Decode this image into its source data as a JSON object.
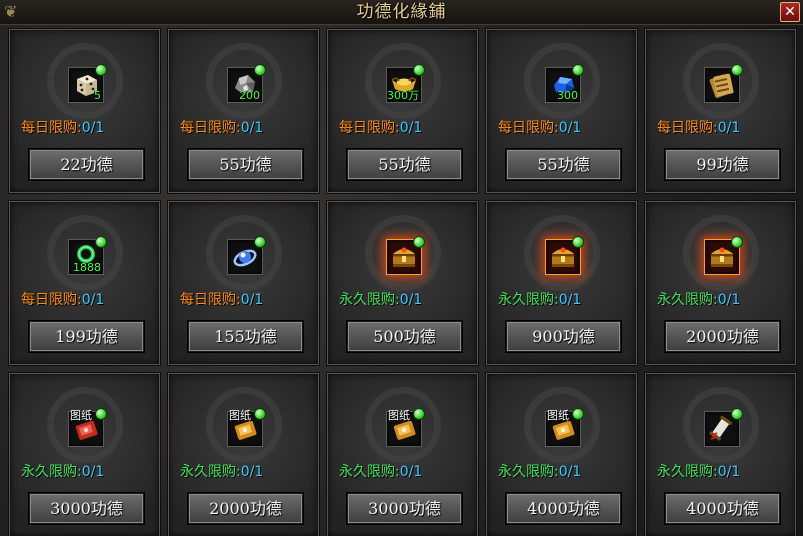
{
  "window": {
    "title": "功德化緣鋪",
    "close_glyph": "✕",
    "ornament": "❦"
  },
  "items": [
    {
      "icon": "dice-icon",
      "qty": "5",
      "tag": "",
      "glow": false,
      "limit_label": "每日限购:",
      "limit_kind": "daily",
      "limit_count": "0/1",
      "price": "22功德"
    },
    {
      "icon": "ore-icon",
      "qty": "200",
      "tag": "",
      "glow": false,
      "limit_label": "每日限购:",
      "limit_kind": "daily",
      "limit_count": "0/1",
      "price": "55功德"
    },
    {
      "icon": "gold-ingot-icon",
      "qty": "300万",
      "tag": "",
      "glow": false,
      "limit_label": "每日限购:",
      "limit_kind": "daily",
      "limit_count": "0/1",
      "price": "55功德"
    },
    {
      "icon": "blue-gem-icon",
      "qty": "300",
      "tag": "",
      "glow": false,
      "limit_label": "每日限购:",
      "limit_kind": "daily",
      "limit_count": "0/1",
      "price": "55功德"
    },
    {
      "icon": "scroll-bundle-icon",
      "qty": "",
      "tag": "",
      "glow": false,
      "limit_label": "每日限购:",
      "limit_kind": "daily",
      "limit_count": "0/1",
      "price": "99功德"
    },
    {
      "icon": "green-ring-icon",
      "qty": "1888",
      "tag": "",
      "glow": false,
      "limit_label": "每日限购:",
      "limit_kind": "daily",
      "limit_count": "0/1",
      "price": "199功德"
    },
    {
      "icon": "blue-orb-icon",
      "qty": "",
      "tag": "",
      "glow": false,
      "limit_label": "每日限购:",
      "limit_kind": "daily",
      "limit_count": "0/1",
      "price": "155功德"
    },
    {
      "icon": "treasure-chest-icon",
      "qty": "",
      "tag": "",
      "glow": true,
      "limit_label": "永久限购:",
      "limit_kind": "perm",
      "limit_count": "0/1",
      "price": "500功德"
    },
    {
      "icon": "treasure-chest-icon",
      "qty": "",
      "tag": "",
      "glow": true,
      "limit_label": "永久限购:",
      "limit_kind": "perm",
      "limit_count": "0/1",
      "price": "900功德"
    },
    {
      "icon": "treasure-chest-icon",
      "qty": "",
      "tag": "",
      "glow": true,
      "limit_label": "永久限购:",
      "limit_kind": "perm",
      "limit_count": "0/1",
      "price": "2000功德"
    },
    {
      "icon": "red-blueprint-icon",
      "qty": "",
      "tag": "图纸",
      "glow": false,
      "limit_label": "永久限购:",
      "limit_kind": "perm",
      "limit_count": "0/1",
      "price": "3000功德"
    },
    {
      "icon": "gold-blueprint-icon",
      "qty": "",
      "tag": "图纸",
      "glow": false,
      "limit_label": "永久限购:",
      "limit_kind": "perm",
      "limit_count": "0/1",
      "price": "2000功德"
    },
    {
      "icon": "gold-blueprint-icon",
      "qty": "",
      "tag": "图纸",
      "glow": false,
      "limit_label": "永久限购:",
      "limit_kind": "perm",
      "limit_count": "0/1",
      "price": "3000功德"
    },
    {
      "icon": "gold-blueprint-icon",
      "qty": "",
      "tag": "图纸",
      "glow": false,
      "limit_label": "永久限购:",
      "limit_kind": "perm",
      "limit_count": "0/1",
      "price": "4000功德"
    },
    {
      "icon": "rolled-scroll-icon",
      "qty": "",
      "tag": "",
      "glow": false,
      "limit_label": "永久限购:",
      "limit_kind": "perm",
      "limit_count": "0/1",
      "price": "4000功德"
    }
  ]
}
